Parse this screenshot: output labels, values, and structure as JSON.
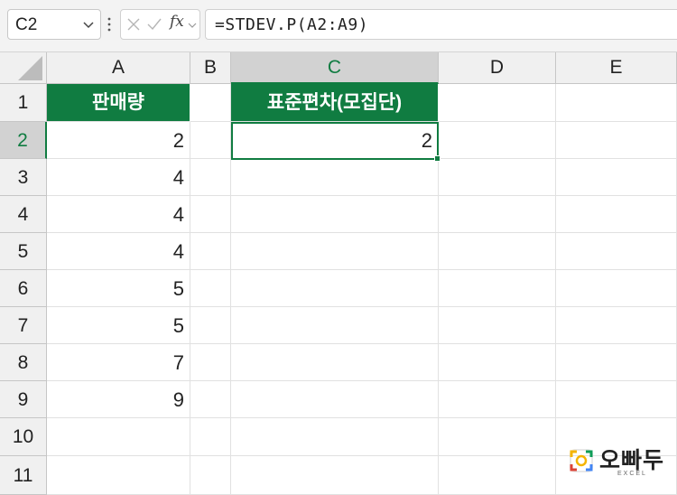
{
  "formula_bar": {
    "name_box": "C2",
    "fx_label": "fx",
    "formula": "=STDEV.P(A2:A9)"
  },
  "columns": [
    {
      "label": "A"
    },
    {
      "label": "B"
    },
    {
      "label": "C"
    },
    {
      "label": "D"
    },
    {
      "label": "E"
    }
  ],
  "rows": [
    "1",
    "2",
    "3",
    "4",
    "5",
    "6",
    "7",
    "8",
    "9",
    "10",
    "11"
  ],
  "cells": {
    "A1": "판매량",
    "C1": "표준편차(모집단)",
    "A2": "2",
    "A3": "4",
    "A4": "4",
    "A5": "4",
    "A6": "5",
    "A7": "5",
    "A8": "7",
    "A9": "9",
    "C2": "2"
  },
  "watermark": {
    "title": "오빠두",
    "subtitle": "EXCEL"
  },
  "colors": {
    "accent": "#107c41",
    "header_fill": "#107c41"
  }
}
